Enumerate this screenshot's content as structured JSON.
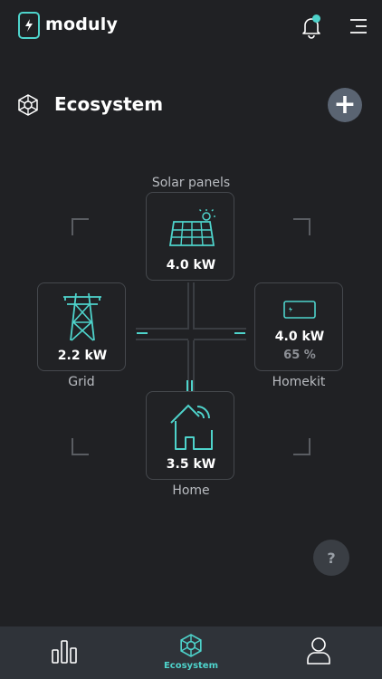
{
  "app": {
    "brand": "moduly"
  },
  "header": {
    "notification_icon": "bell-icon",
    "menu_icon": "hamburger-menu-icon",
    "accent": "#4ed3cb"
  },
  "section": {
    "title": "Ecosystem",
    "add_label": "+"
  },
  "nodes": {
    "solar": {
      "label": "Solar panels",
      "value": "4.0 kW"
    },
    "grid": {
      "label": "Grid",
      "value": "2.2 kW"
    },
    "homekit": {
      "label": "Homekit",
      "value": "4.0 kW",
      "battery": "65 %"
    },
    "home": {
      "label": "Home",
      "value": "3.5 kW"
    }
  },
  "help": {
    "label": "?"
  },
  "nav": {
    "items": [
      {
        "label": "",
        "icon": "bar-chart-icon"
      },
      {
        "label": "Ecosystem",
        "icon": "ecosystem-icon",
        "active": true
      },
      {
        "label": "",
        "icon": "user-icon"
      }
    ]
  }
}
